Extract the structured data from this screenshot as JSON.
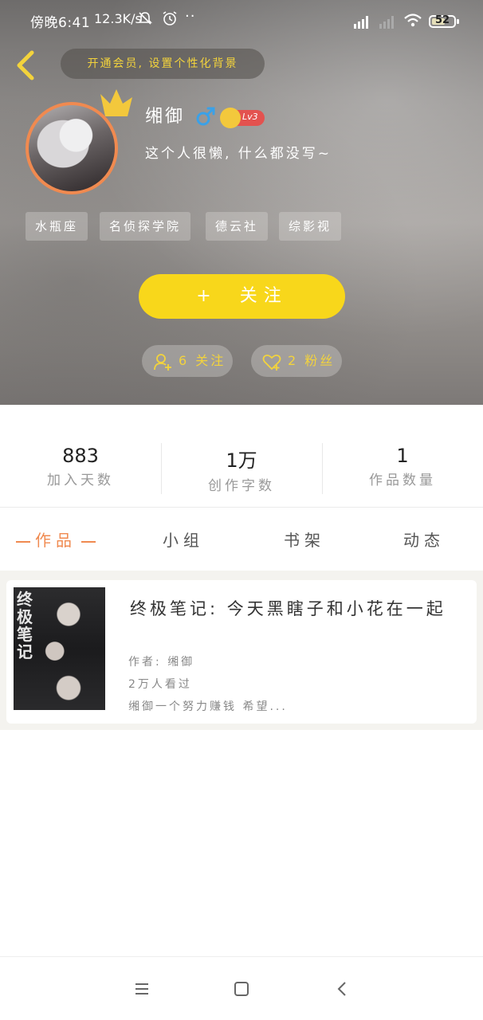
{
  "status_bar": {
    "time": "傍晚6:41",
    "speed": "12.3K/s",
    "extra": "··",
    "battery": "52"
  },
  "profile": {
    "vip_prompt": "开通会员, 设置个性化背景",
    "username": "缃御",
    "gender": "♂",
    "level": "Lv3",
    "bio": "这个人很懒, 什么都没写~",
    "tags": [
      "水瓶座",
      "名侦探学院",
      "德云社",
      "综影视"
    ],
    "follow_label": "关注",
    "follow_plus": "+",
    "following_label": "6 关注",
    "fans_label": "2 粉丝"
  },
  "stats": [
    {
      "value": "883",
      "label": "加入天数"
    },
    {
      "value": "1万",
      "label": "创作字数"
    },
    {
      "value": "1",
      "label": "作品数量"
    }
  ],
  "tabs": [
    {
      "label": "作品",
      "active": true
    },
    {
      "label": "小组",
      "active": false
    },
    {
      "label": "书架",
      "active": false
    },
    {
      "label": "动态",
      "active": false
    }
  ],
  "works": [
    {
      "cover_text": "终极笔记",
      "title": "终极笔记: 今天黑瞎子和小花在一起",
      "author": "作者: 缃御",
      "views": "2万人看过",
      "summary": "缃御一个努力赚钱 希望..."
    }
  ],
  "colors": {
    "accent": "#f08a50",
    "follow_button": "#f8d71b",
    "vip_text": "#f3d33c",
    "level_badge": "#e3524f"
  }
}
